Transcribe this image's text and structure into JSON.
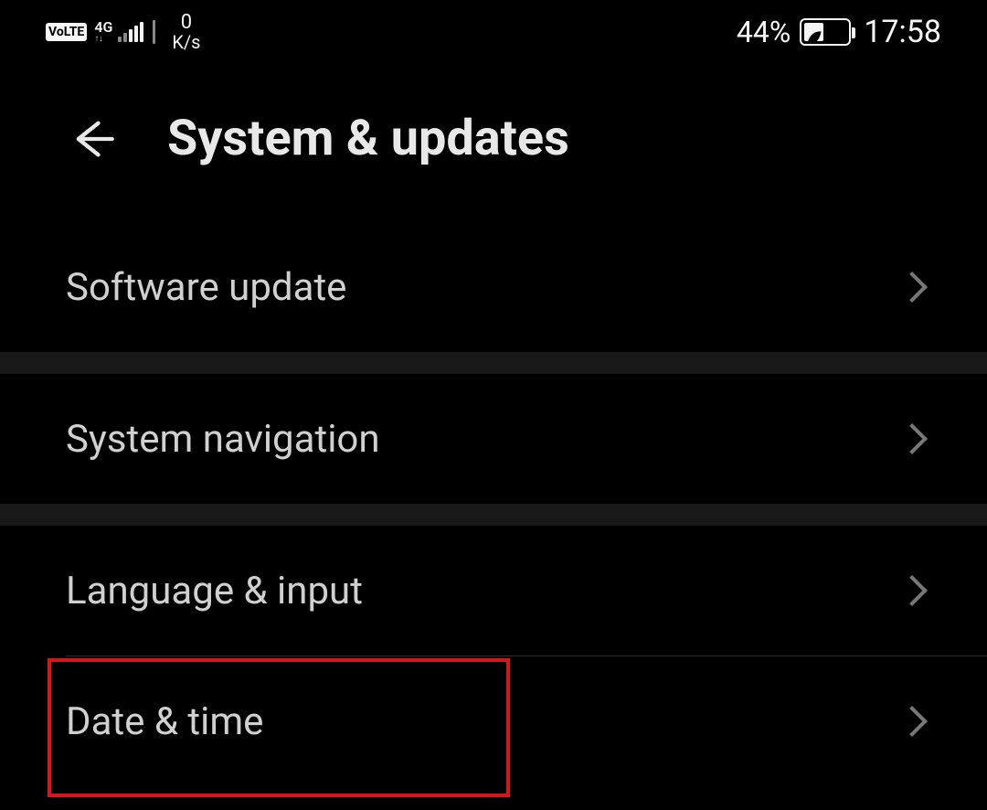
{
  "status_bar": {
    "volte_label": "VoLTE",
    "network_type": "4G",
    "network_arrows": "↑↓",
    "speed_value": "0",
    "speed_unit": "K/s",
    "battery_percent": "44%",
    "time": "17:58"
  },
  "header": {
    "title": "System & updates"
  },
  "rows": {
    "software_update": "Software update",
    "system_navigation": "System navigation",
    "language_input": "Language & input",
    "date_time": "Date & time"
  }
}
